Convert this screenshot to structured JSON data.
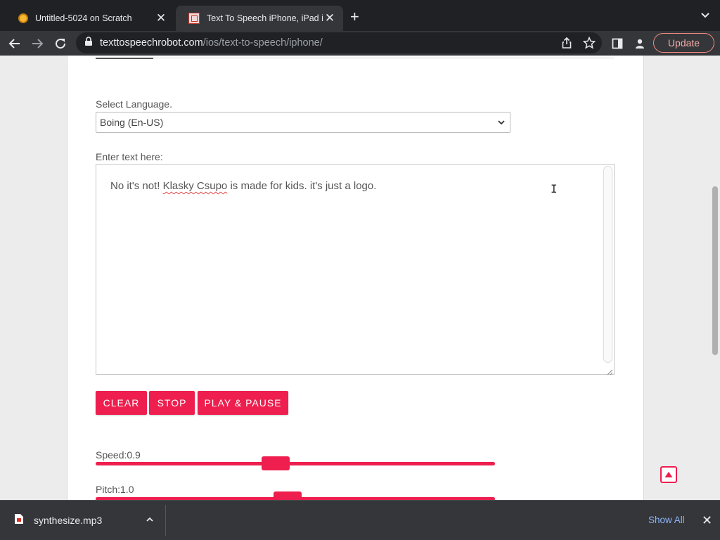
{
  "browser": {
    "tabs": [
      {
        "title": "Untitled-5024 on Scratch",
        "active": false,
        "favicon": "scratch-icon"
      },
      {
        "title": "Text To Speech iPhone, iPad iOS",
        "active": true,
        "favicon": "tts-robot-icon"
      }
    ],
    "url_host": "texttospeechrobot.com",
    "url_path": "/ios/text-to-speech/iphone/",
    "update_label": "Update"
  },
  "page": {
    "language_label": "Select Language.",
    "language_value": "Boing (En-US)",
    "text_label": "Enter text here:",
    "text_before": "No it's not! ",
    "text_misspelled": "Klasky Csupo",
    "text_after": " is made for kids. it's just a logo.",
    "buttons": {
      "clear": "CLEAR",
      "stop": "STOP",
      "play_pause": "PLAY & PAUSE"
    },
    "speed_label": "Speed:0.9",
    "speed_fraction": 0.45,
    "pitch_label": "Pitch:1.0",
    "pitch_fraction": 0.48,
    "accent_color": "#ee1f4f"
  },
  "downloads": {
    "file_name": "synthesize.mp3",
    "show_all": "Show All"
  }
}
